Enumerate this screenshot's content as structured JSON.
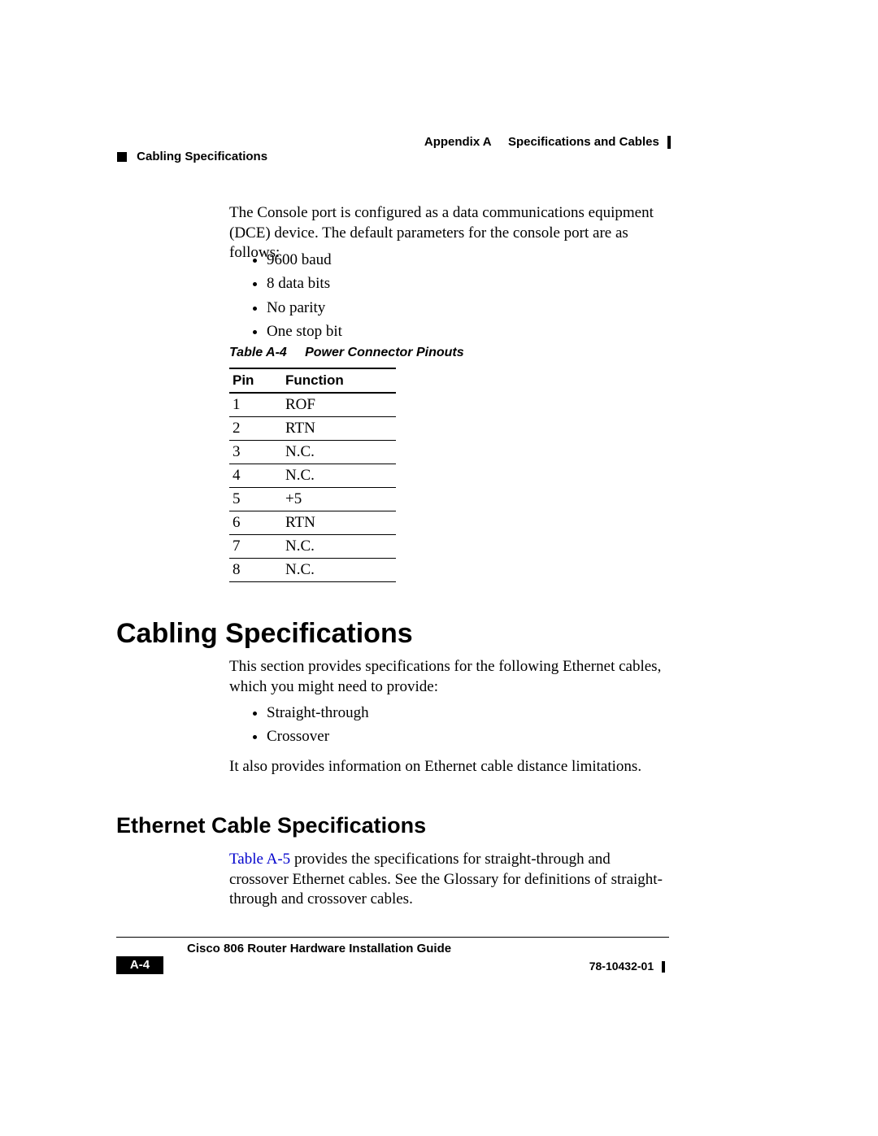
{
  "header": {
    "appendix": "Appendix A",
    "appendix_title": "Specifications and Cables",
    "section_crumb": "Cabling Specifications"
  },
  "intro_para": "The Console port is configured as a data communications equipment (DCE) device. The default parameters for the console port are as follows:",
  "console_params": [
    "9600 baud",
    "8 data bits",
    "No parity",
    "One stop bit"
  ],
  "table_a4": {
    "caption_label": "Table A-4",
    "caption_title": "Power Connector Pinouts",
    "headers": {
      "pin": "Pin",
      "function": "Function"
    },
    "rows": [
      {
        "pin": "1",
        "function": "ROF"
      },
      {
        "pin": "2",
        "function": "RTN"
      },
      {
        "pin": "3",
        "function": "N.C."
      },
      {
        "pin": "4",
        "function": "N.C."
      },
      {
        "pin": "5",
        "function": "+5"
      },
      {
        "pin": "6",
        "function": "RTN"
      },
      {
        "pin": "7",
        "function": "N.C."
      },
      {
        "pin": "8",
        "function": "N.C."
      }
    ]
  },
  "h1": "Cabling Specifications",
  "cabling_intro": "This section provides specifications for the following Ethernet cables, which you might need to provide:",
  "cable_types": [
    "Straight-through",
    "Crossover"
  ],
  "cabling_outro": "It also provides information on Ethernet cable distance limitations.",
  "h2": "Ethernet Cable Specifications",
  "eth_para": {
    "link": "Table A-5",
    "rest": " provides the specifications for straight-through and crossover Ethernet cables. See the Glossary for definitions of straight-through and crossover cables."
  },
  "footer": {
    "guide": "Cisco 806 Router Hardware Installation Guide",
    "page": "A-4",
    "docnum": "78-10432-01"
  }
}
